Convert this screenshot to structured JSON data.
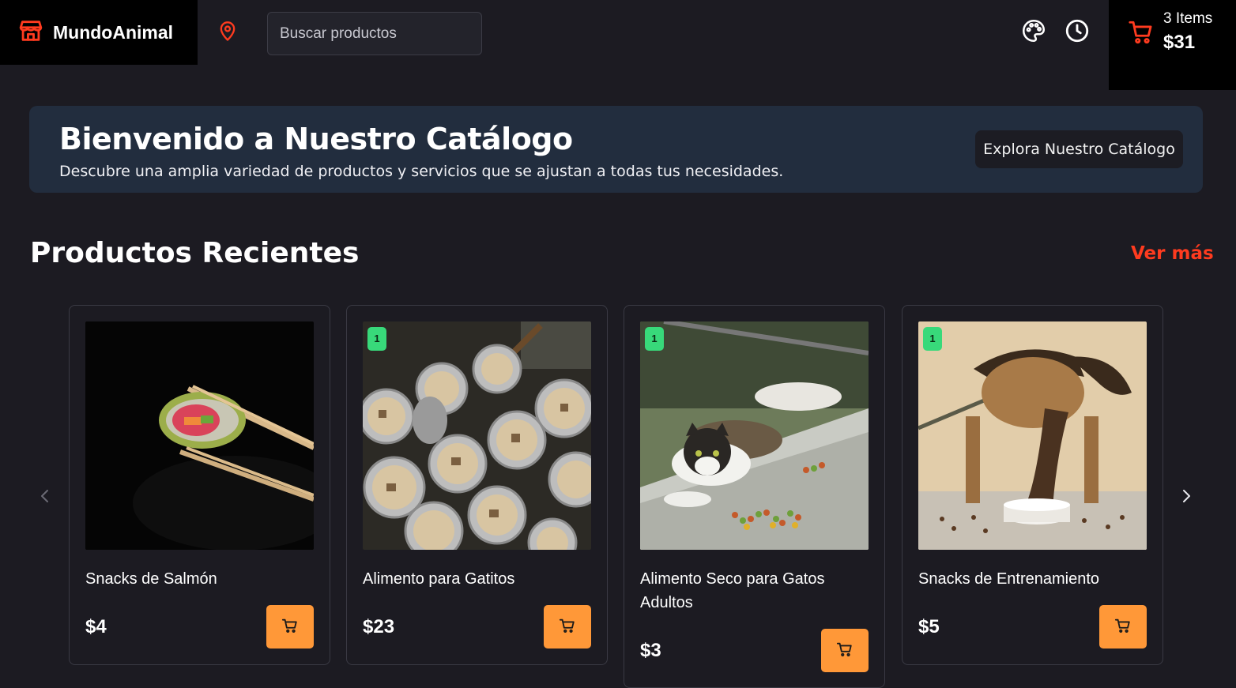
{
  "header": {
    "brand_name": "MundoAnimal",
    "search_placeholder": "Buscar productos",
    "cart": {
      "count_label": "3 Items",
      "total": "$31"
    },
    "icons": [
      "store-icon",
      "location-pin-icon",
      "palette-icon",
      "clock-icon",
      "cart-icon"
    ]
  },
  "hero": {
    "title": "Bienvenido a Nuestro Catálogo",
    "subtitle": "Descubre una amplia variedad de productos y servicios que se ajustan a todas tus necesidades.",
    "button_label": "Explora Nuestro Catálogo"
  },
  "section": {
    "title": "Productos Recientes",
    "see_more": "Ver más"
  },
  "products": [
    {
      "name": "Snacks de Salmón",
      "price": "$4",
      "badge": null,
      "image": "salmon-sushi-chopsticks"
    },
    {
      "name": "Alimento para Gatitos",
      "price": "$23",
      "badge": "1",
      "image": "pots-of-food"
    },
    {
      "name": "Alimento Seco para Gatos Adultos",
      "price": "$3",
      "badge": "1",
      "image": "cats-eating-kibble"
    },
    {
      "name": "Snacks de Entrenamiento",
      "price": "$5",
      "badge": "1",
      "image": "dog-eating-bowl"
    }
  ],
  "colors": {
    "accent_red": "#ff3b1f",
    "add_button": "#ff9838",
    "badge": "#38d97a",
    "background": "#1c1b22",
    "hero_bg": "#222d3e"
  }
}
